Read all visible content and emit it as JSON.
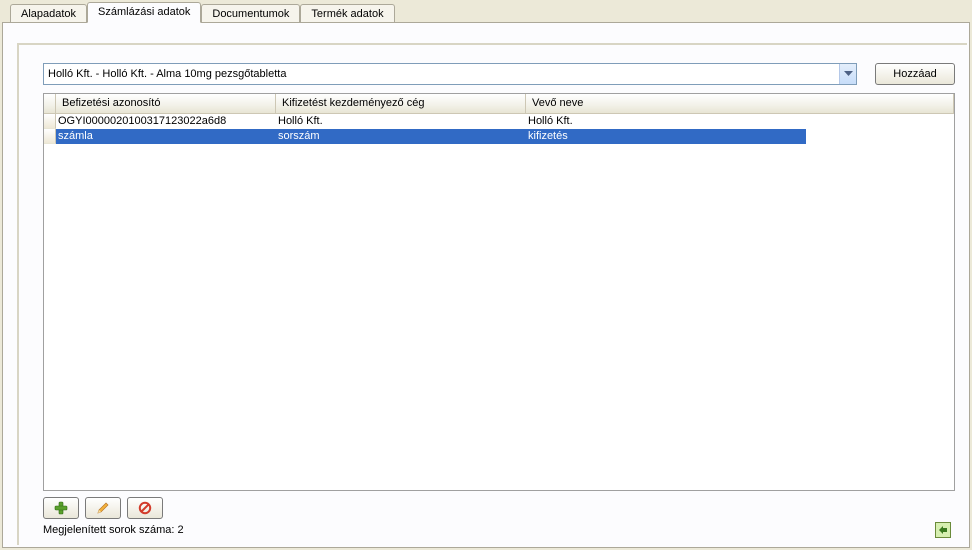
{
  "tabs": {
    "t0": "Alapadatok",
    "t1": "Számlázási adatok",
    "t2": "Documentumok",
    "t3": "Termék adatok"
  },
  "combo": {
    "text": "Holló Kft. - Holló Kft. - Alma 10mg pezsgőtabletta"
  },
  "buttons": {
    "add": "Hozzáad"
  },
  "grid": {
    "headers": {
      "h1": "Befizetési azonosító",
      "h2": "Kifizetést kezdeményező cég",
      "h3": "Vevő neve"
    },
    "rows": [
      {
        "c1": "OGYI0000020100317123022a6d8",
        "c2": "Holló Kft.",
        "c3": "Holló Kft."
      },
      {
        "c1": "számla",
        "c2": "sorszám",
        "c3": "kifizetés"
      }
    ]
  },
  "status": {
    "text": "Megjelenített sorok száma: 2"
  }
}
